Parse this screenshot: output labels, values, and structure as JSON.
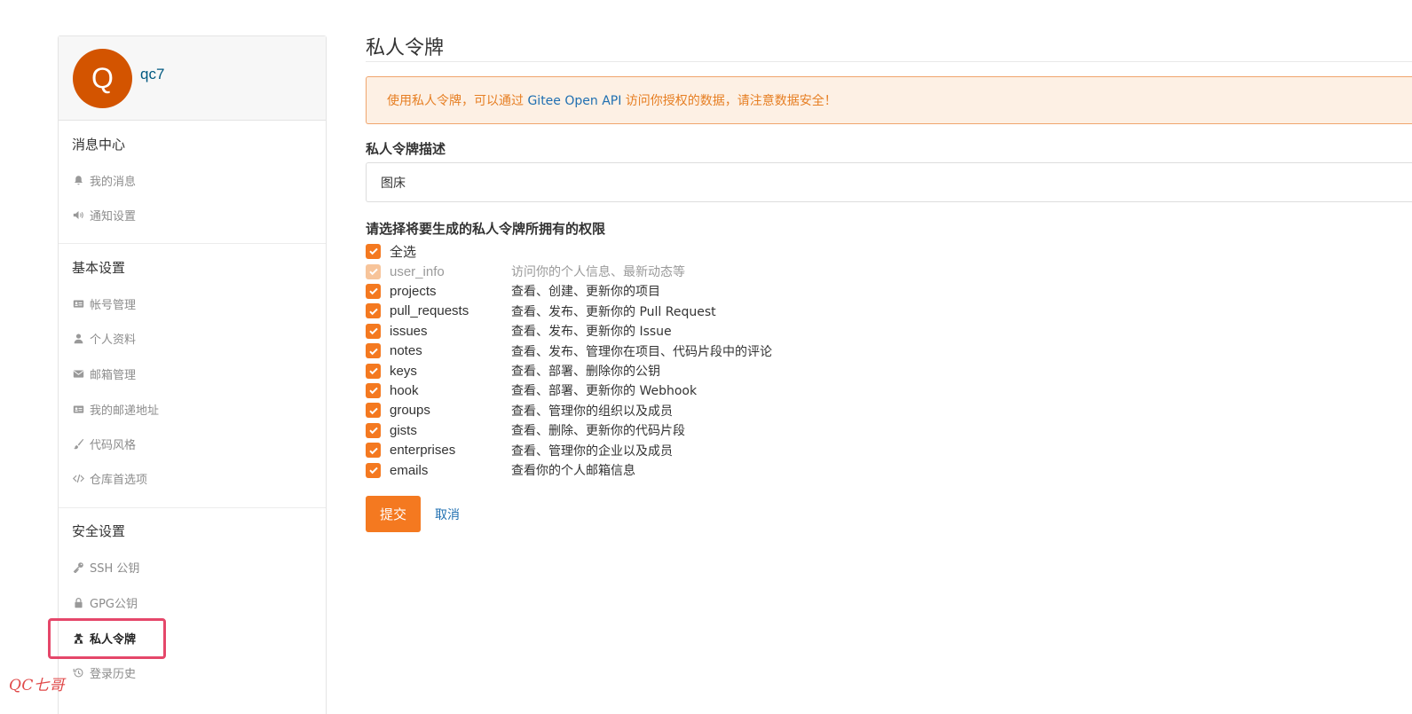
{
  "user": {
    "avatar_letter": "Q",
    "name": "qc7"
  },
  "sidebar": {
    "sections": [
      {
        "title": "消息中心",
        "items": [
          {
            "label": "我的消息",
            "icon": "bell-icon"
          },
          {
            "label": "通知设置",
            "icon": "volume-icon"
          }
        ]
      },
      {
        "title": "基本设置",
        "items": [
          {
            "label": "帐号管理",
            "icon": "id-card-icon"
          },
          {
            "label": "个人资料",
            "icon": "user-icon"
          },
          {
            "label": "邮箱管理",
            "icon": "envelope-icon"
          },
          {
            "label": "我的邮递地址",
            "icon": "address-card-icon"
          },
          {
            "label": "代码风格",
            "icon": "brush-icon"
          },
          {
            "label": "仓库首选项",
            "icon": "code-icon"
          }
        ]
      },
      {
        "title": "安全设置",
        "items": [
          {
            "label": "SSH 公钥",
            "icon": "key-icon"
          },
          {
            "label": "GPG公钥",
            "icon": "lock-icon"
          },
          {
            "label": "私人令牌",
            "icon": "user-secret-icon",
            "active": true
          },
          {
            "label": "登录历史",
            "icon": "history-icon"
          }
        ]
      }
    ]
  },
  "watermark": "QC七哥",
  "main": {
    "title": "私人令牌",
    "notice": {
      "prefix": "使用私人令牌，可以通过 ",
      "link": "Gitee Open API",
      "suffix": " 访问你授权的数据，请注意数据安全！"
    },
    "description_label": "私人令牌描述",
    "description_value": "图床",
    "permissions_label": "请选择将要生成的私人令牌所拥有的权限",
    "select_all_label": "全选",
    "permissions": [
      {
        "name": "user_info",
        "desc": "访问你的个人信息、最新动态等",
        "disabled": true
      },
      {
        "name": "projects",
        "desc": "查看、创建、更新你的项目"
      },
      {
        "name": "pull_requests",
        "desc": "查看、发布、更新你的 Pull Request"
      },
      {
        "name": "issues",
        "desc": "查看、发布、更新你的 Issue"
      },
      {
        "name": "notes",
        "desc": "查看、发布、管理你在项目、代码片段中的评论"
      },
      {
        "name": "keys",
        "desc": "查看、部署、删除你的公钥"
      },
      {
        "name": "hook",
        "desc": "查看、部署、更新你的 Webhook"
      },
      {
        "name": "groups",
        "desc": "查看、管理你的组织以及成员"
      },
      {
        "name": "gists",
        "desc": "查看、删除、更新你的代码片段"
      },
      {
        "name": "enterprises",
        "desc": "查看、管理你的企业以及成员"
      },
      {
        "name": "emails",
        "desc": "查看你的个人邮箱信息"
      }
    ],
    "submit_label": "提交",
    "cancel_label": "取消"
  },
  "colors": {
    "accent": "#f47920",
    "link": "#1f6fb1",
    "highlight": "#e5476a",
    "avatar": "#d35400"
  }
}
